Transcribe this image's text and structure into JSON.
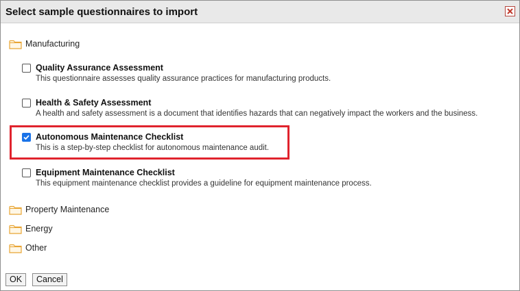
{
  "dialog": {
    "title": "Select sample questionnaires to import",
    "close_icon": "close-icon",
    "accent_close": "#c0392b"
  },
  "folders": [
    {
      "label": "Manufacturing",
      "icon": "folder-icon"
    },
    {
      "label": "Property Maintenance",
      "icon": "folder-icon"
    },
    {
      "label": "Energy",
      "icon": "folder-icon"
    },
    {
      "label": "Other",
      "icon": "folder-icon"
    }
  ],
  "items": [
    {
      "title": "Quality Assurance Assessment",
      "description": "This questionnaire assesses quality assurance practices for manufacturing products.",
      "checked": false
    },
    {
      "title": "Health & Safety Assessment",
      "description": "A health and safety assessment is a document that identifies hazards that can negatively impact the workers and the business.",
      "checked": false
    },
    {
      "title": "Autonomous Maintenance Checklist",
      "description": "This is a step-by-step checklist for autonomous maintenance audit.",
      "checked": true
    },
    {
      "title": "Equipment Maintenance Checklist",
      "description": "This equipment maintenance checklist provides a guideline for equipment maintenance process.",
      "checked": false
    }
  ],
  "buttons": {
    "ok_label": "OK",
    "cancel_label": "Cancel"
  },
  "colors": {
    "highlight": "#e0232d",
    "checkbox_checked": "#1a73e8",
    "folder": "#f5b942"
  }
}
